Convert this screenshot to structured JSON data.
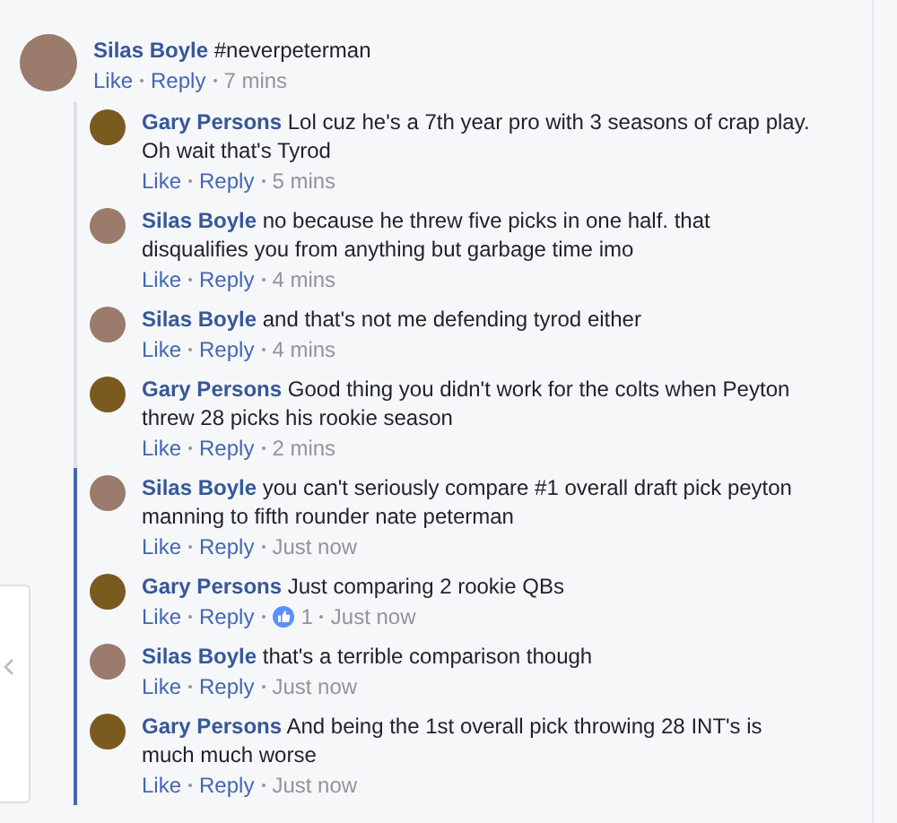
{
  "top_comment": {
    "author": "Silas Boyle",
    "text": "#neverpeterman",
    "color": "#9a7b6c",
    "actions": [
      "Like",
      "Reply"
    ],
    "time": "7 mins"
  },
  "replies": [
    {
      "author": "Gary Persons",
      "text": "Lol cuz he's a 7th year pro with 3 seasons of crap play. Oh wait that's Tyrod",
      "color": "#7a5a1e",
      "highlighted": false,
      "actions": [
        "Like",
        "Reply"
      ],
      "time": "5 mins"
    },
    {
      "author": "Silas Boyle",
      "text": "no because he threw five picks in one half. that disqualifies you from anything but garbage time imo",
      "color": "#9a7b6c",
      "highlighted": false,
      "actions": [
        "Like",
        "Reply"
      ],
      "time": "4 mins"
    },
    {
      "author": "Silas Boyle",
      "text": "and that's not me defending tyrod either",
      "color": "#9a7b6c",
      "highlighted": false,
      "actions": [
        "Like",
        "Reply"
      ],
      "time": "4 mins"
    },
    {
      "author": "Gary Persons",
      "text": "Good thing you didn't work for the colts when Peyton threw 28 picks his rookie season",
      "color": "#7a5a1e",
      "highlighted": false,
      "actions": [
        "Like",
        "Reply"
      ],
      "time": "2 mins"
    },
    {
      "author": "Silas Boyle",
      "text": "you can't seriously compare #1 overall draft pick peyton manning to fifth rounder nate peterman",
      "color": "#9a7b6c",
      "highlighted": true,
      "actions": [
        "Like",
        "Reply"
      ],
      "time": "Just now"
    },
    {
      "author": "Gary Persons",
      "text": "Just comparing 2 rookie QBs",
      "color": "#7a5a1e",
      "highlighted": true,
      "actions": [
        "Like",
        "Reply"
      ],
      "likes": "1",
      "time": "Just now"
    },
    {
      "author": "Silas Boyle",
      "text": "that's a terrible comparison though",
      "color": "#9a7b6c",
      "highlighted": true,
      "actions": [
        "Like",
        "Reply"
      ],
      "time": "Just now"
    },
    {
      "author": "Gary Persons",
      "text": "And being the 1st overall pick throwing 28 INT's is much much worse",
      "color": "#7a5a1e",
      "highlighted": true,
      "actions": [
        "Like",
        "Reply"
      ],
      "time": "Just now"
    }
  ]
}
